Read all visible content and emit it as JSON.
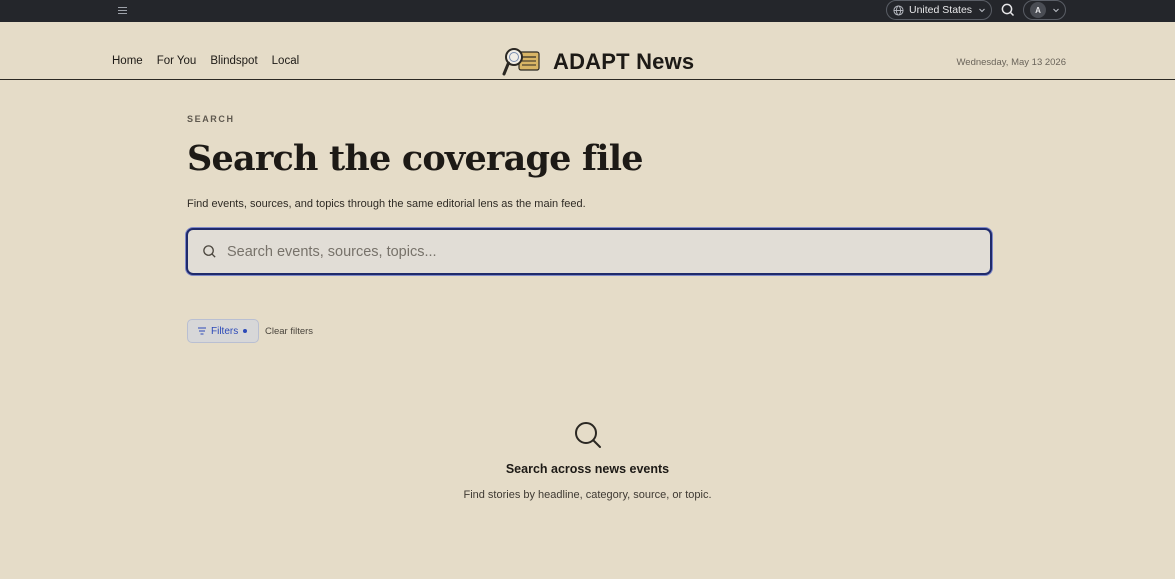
{
  "topbar": {
    "region_label": "United States",
    "account_initial": "A"
  },
  "nav": {
    "items": [
      "Home",
      "For You",
      "Blindspot",
      "Local"
    ]
  },
  "brand": {
    "name": "ADAPT News"
  },
  "dateline": "Wednesday, May 13 2026",
  "search_page": {
    "eyebrow": "SEARCH",
    "title": "Search the coverage file",
    "subtitle": "Find events, sources, and topics through the same editorial lens as the main feed.",
    "input_value": "",
    "input_placeholder": "Search events, sources, topics...",
    "filters_label": "Filters",
    "clear_filters_label": "Clear filters"
  },
  "empty_state": {
    "title": "Search across news events",
    "text": "Find stories by headline, category, source, or topic."
  },
  "colors": {
    "page_bg": "#e5dcc8",
    "topbar_bg": "#24262b",
    "accent": "#2c49b8",
    "focus_ring": "#1f2a6b"
  },
  "icons": [
    "menu-icon",
    "globe-icon",
    "chevron-down-icon",
    "search-icon",
    "magnifier-logo-icon",
    "filter-icon"
  ]
}
